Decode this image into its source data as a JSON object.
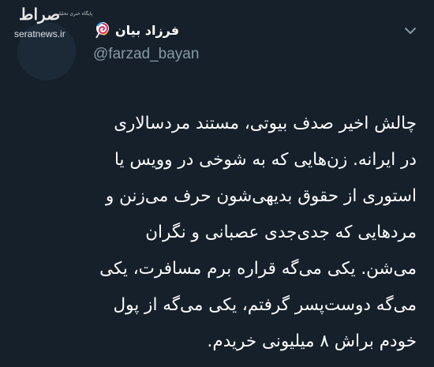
{
  "watermark": {
    "logo": "صراط",
    "tagline": "پایگاه خبری تحلیلی",
    "site": "seratnews.ir"
  },
  "user": {
    "display_name": "فرزاد بیان",
    "handle": "@farzad_bayan",
    "emoji_icon": "lollipop-icon"
  },
  "menu": {
    "icon": "chevron-down-icon"
  },
  "tweet": {
    "lines": [
      "چالش اخیر صدف بیوتی، مستند مردسالاری",
      "در ایرانه. زن‌هایی که به شوخی در وویس یا",
      "استوری از حقوق بدیهی‌شون حرف می‌زنن و",
      "مردهایی که جدی‌جدی عصبانی و نگران",
      "می‌شن. یکی می‌گه قراره برم مسافرت، یکی",
      "می‌گه دوست‌پسر گرفتم، یکی می‌گه از پول",
      "خودم براش ۸ میلیونی خریدم."
    ]
  },
  "colors": {
    "background": "#15202b",
    "text": "#ffffff",
    "secondary": "#8899a6"
  }
}
